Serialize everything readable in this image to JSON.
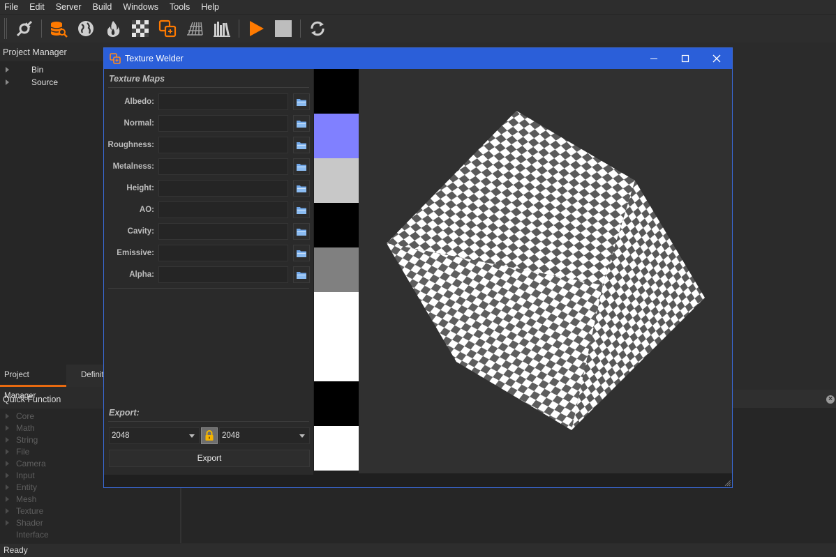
{
  "menu": [
    "File",
    "Edit",
    "Server",
    "Build",
    "Windows",
    "Tools",
    "Help"
  ],
  "toolbar": {
    "icons": [
      "connect-icon",
      "database-search-icon",
      "globe-icon",
      "fire-icon",
      "checker-icon",
      "texture-welder-icon",
      "grid-icon",
      "library-icon",
      "play-icon",
      "stop-icon",
      "refresh-icon"
    ],
    "accent": "#ff7a00"
  },
  "project_manager": {
    "title": "Project Manager",
    "items": [
      "Bin",
      "Source"
    ]
  },
  "tabs": [
    "Project Manager",
    "Definit"
  ],
  "quick_function": {
    "title": "Quick Function",
    "items": [
      "Core",
      "Math",
      "String",
      "File",
      "Camera",
      "Input",
      "Entity",
      "Mesh",
      "Texture",
      "Shader",
      "Interface"
    ]
  },
  "status": "Ready",
  "window": {
    "title": "Texture Welder",
    "title_color": "#2b5fd9",
    "texture_maps_label": "Texture Maps",
    "maps": [
      {
        "label": "Albedo:",
        "value": ""
      },
      {
        "label": "Normal:",
        "value": ""
      },
      {
        "label": "Roughness:",
        "value": ""
      },
      {
        "label": "Metalness:",
        "value": ""
      },
      {
        "label": "Height:",
        "value": ""
      },
      {
        "label": "AO:",
        "value": ""
      },
      {
        "label": "Cavity:",
        "value": ""
      },
      {
        "label": "Emissive:",
        "value": ""
      },
      {
        "label": "Alpha:",
        "value": ""
      }
    ],
    "export_label": "Export:",
    "width_value": "2048",
    "height_value": "2048",
    "export_button": "Export",
    "swatches": [
      "#000000",
      "#8080ff",
      "#c8c8c8",
      "#000000",
      "#808080",
      "#ffffff",
      "#ffffff",
      "#000000",
      "#ffffff"
    ]
  }
}
